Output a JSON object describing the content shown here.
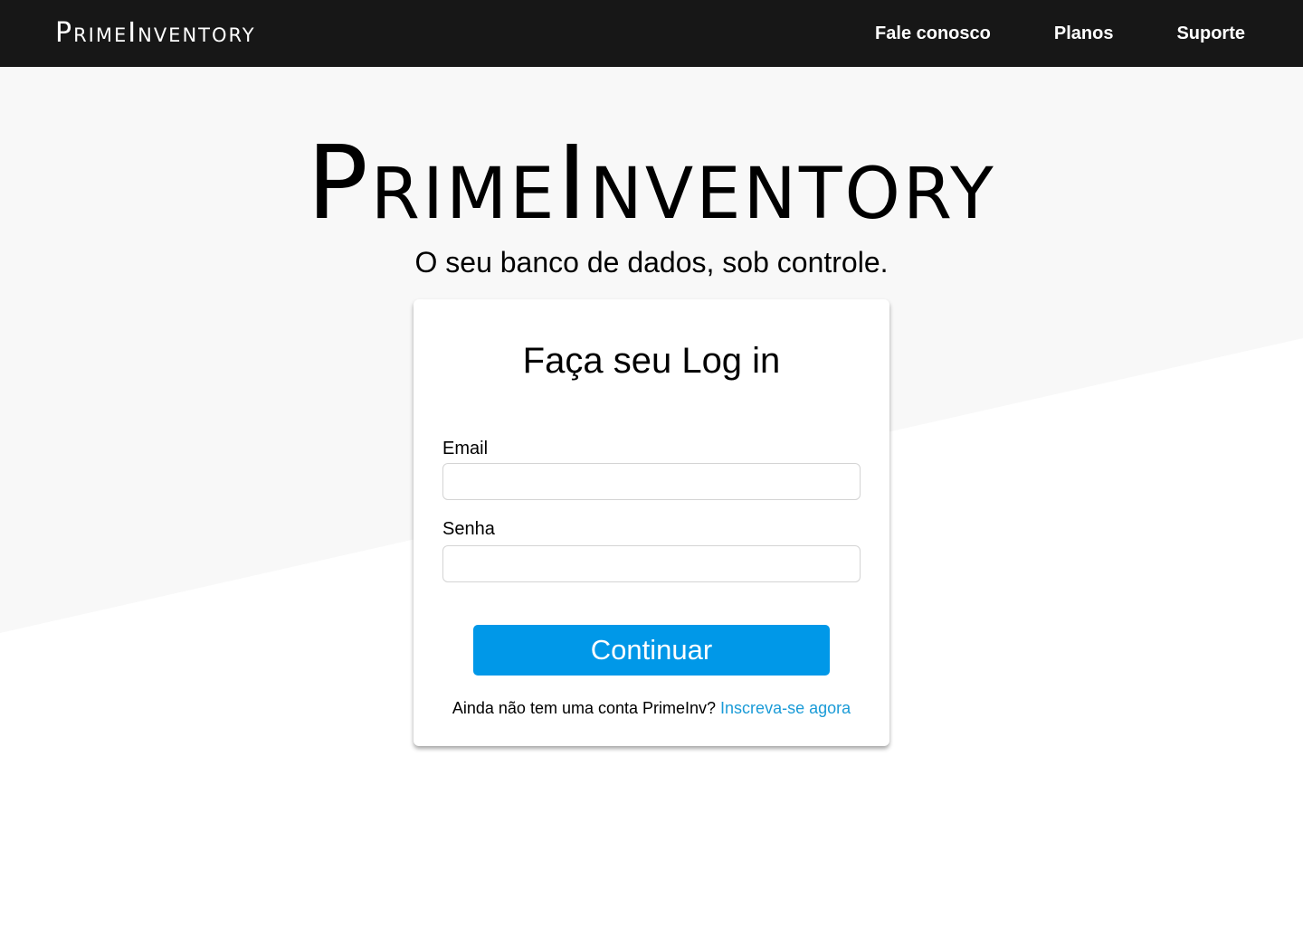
{
  "nav": {
    "logo": "PrimeInventory",
    "links": [
      "Fale conosco",
      "Planos",
      "Suporte"
    ]
  },
  "hero": {
    "logo": "PrimeInventory",
    "tagline": "O seu banco de dados, sob controle."
  },
  "login": {
    "title": "Faça seu Log in",
    "email_label": "Email",
    "email_value": "",
    "password_label": "Senha",
    "password_value": "",
    "continue_label": "Continuar",
    "signup_prompt": "Ainda não tem uma conta PrimeInv?",
    "signup_link": "Inscreva-se agora"
  },
  "colors": {
    "nav_bg": "#171717",
    "page_bg": "#ffffff",
    "shape_bg": "#f8f8f8",
    "accent": "#0098e8",
    "link": "#1a9bd7"
  }
}
